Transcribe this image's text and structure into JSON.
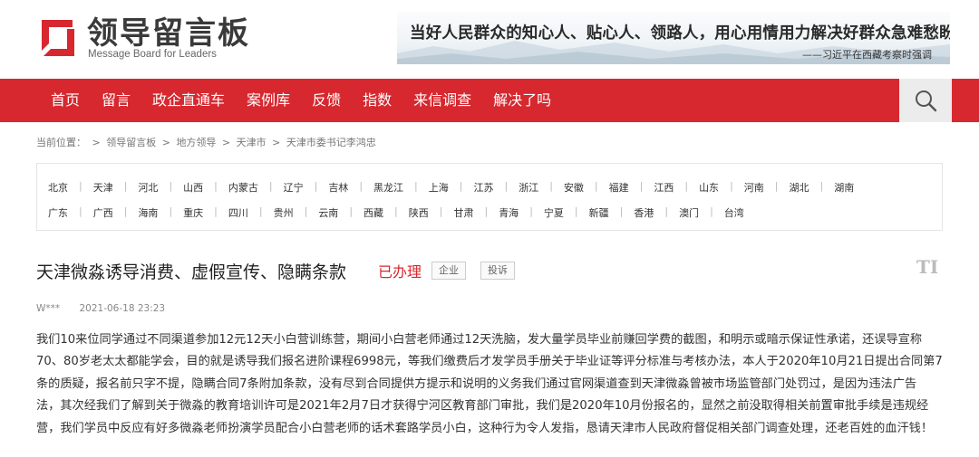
{
  "logo": {
    "cn": "领导留言板",
    "en": "Message Board for Leaders"
  },
  "banner": {
    "quote": "当好人民群众的知心人、贴心人、领路人，用心用情用力解决好群众急难愁盼问题。",
    "source": "——习近平在西藏考察时强调"
  },
  "nav": {
    "items": [
      "首页",
      "留言",
      "政企直通车",
      "案例库",
      "反馈",
      "指数",
      "来信调查",
      "解决了吗"
    ],
    "search_icon": "search-icon"
  },
  "breadcrumb": {
    "prefix": "当前位置：",
    "items": [
      "领导留言板",
      "地方领导",
      "天津市",
      "天津市委书记李鸿忠"
    ],
    "sep": ">"
  },
  "regions": {
    "row1": [
      "北京",
      "天津",
      "河北",
      "山西",
      "内蒙古",
      "辽宁",
      "吉林",
      "黑龙江",
      "上海",
      "江苏",
      "浙江",
      "安徽",
      "福建",
      "江西",
      "山东",
      "河南",
      "湖北",
      "湖南"
    ],
    "row2": [
      "广东",
      "广西",
      "海南",
      "重庆",
      "四川",
      "贵州",
      "云南",
      "西藏",
      "陕西",
      "甘肃",
      "青海",
      "宁夏",
      "新疆",
      "香港",
      "澳门",
      "台湾"
    ],
    "sep": "|"
  },
  "article": {
    "title": "天津微淼诱导消费、虚假宣传、隐瞒条款",
    "status": "已办理",
    "tags": [
      "企业",
      "投诉"
    ],
    "font_icon": "TI",
    "author": "W***",
    "date": "2021-06-18 23:23",
    "lines": [
      "我们10来位同学通过不同渠道参加12元12天小白营训练营，期间小白营老师通过12天洗脑，发大量学员毕业前赚回学费的截图，和明示或暗示保证性承诺，还误导宣称",
      "70、80岁老太太都能学会，目的就是诱导我们报名进阶课程6998元，等我们缴费后才发学员手册关于毕业证等评分标准与考核办法，本人于2020年10月21日提出合同第7",
      "条的质疑，报名前只字不提，隐瞒合同7条附加条款，没有尽到合同提供方提示和说明的义务我们通过官网渠道查到天津微淼曾被市场监管部门处罚过，是因为违法广告",
      "法，其次经我们了解到关于微淼的教育培训许可是2021年2月7日才获得宁河区教育部门审批，我们是2020年10月份报名的，显然之前没取得相关前置审批手续是违规经",
      "营，我们学员中反应有好多微淼老师扮演学员配合小白营老师的话术套路学员小白，这种行为令人发指，恳请天津市人民政府督促相关部门调查处理，还老百姓的血汗钱！"
    ]
  },
  "colors": {
    "brand_red": "#d7282f",
    "nav_bg": "#d7282f"
  }
}
